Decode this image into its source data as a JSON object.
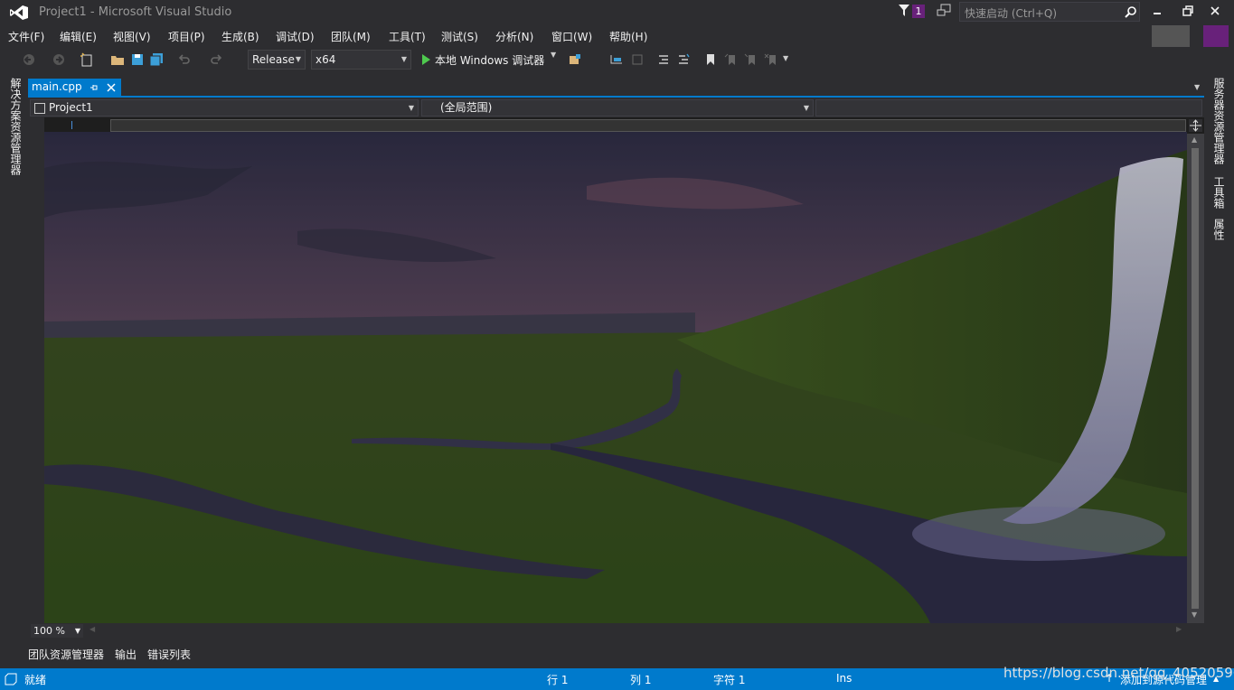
{
  "window": {
    "title": "Project1 - Microsoft Visual Studio",
    "notification_count": "1",
    "quick_launch_placeholder": "快速启动 (Ctrl+Q)"
  },
  "menu": [
    "文件(F)",
    "编辑(E)",
    "视图(V)",
    "项目(P)",
    "生成(B)",
    "调试(D)",
    "团队(M)",
    "工具(T)",
    "测试(S)",
    "分析(N)",
    "窗口(W)",
    "帮助(H)"
  ],
  "toolbar": {
    "configuration": "Release",
    "platform": "x64",
    "run_label": "本地 Windows 调试器"
  },
  "left_side_tabs": [
    "解决方案资源管理器"
  ],
  "right_side_tabs": [
    "服务器资源管理器",
    "工具箱",
    "属性"
  ],
  "document_tab": {
    "name": "main.cpp"
  },
  "navigation_bar": {
    "project": "Project1",
    "scope": "(全局范围)",
    "member": ""
  },
  "editor": {
    "zoom": "100 %"
  },
  "bottom_tabs": [
    "团队资源管理器",
    "输出",
    "错误列表"
  ],
  "status_bar": {
    "state": "就绪",
    "line": "行 1",
    "column": "列 1",
    "char": "字符 1",
    "mode": "Ins",
    "source_control": "添加到源代码管理"
  },
  "watermark": "https://blog.csdn.net/qq_40520596",
  "colors": {
    "accent": "#007acc",
    "background": "#2d2d30",
    "editor": "#1e1e1e",
    "badge": "#68217a"
  }
}
